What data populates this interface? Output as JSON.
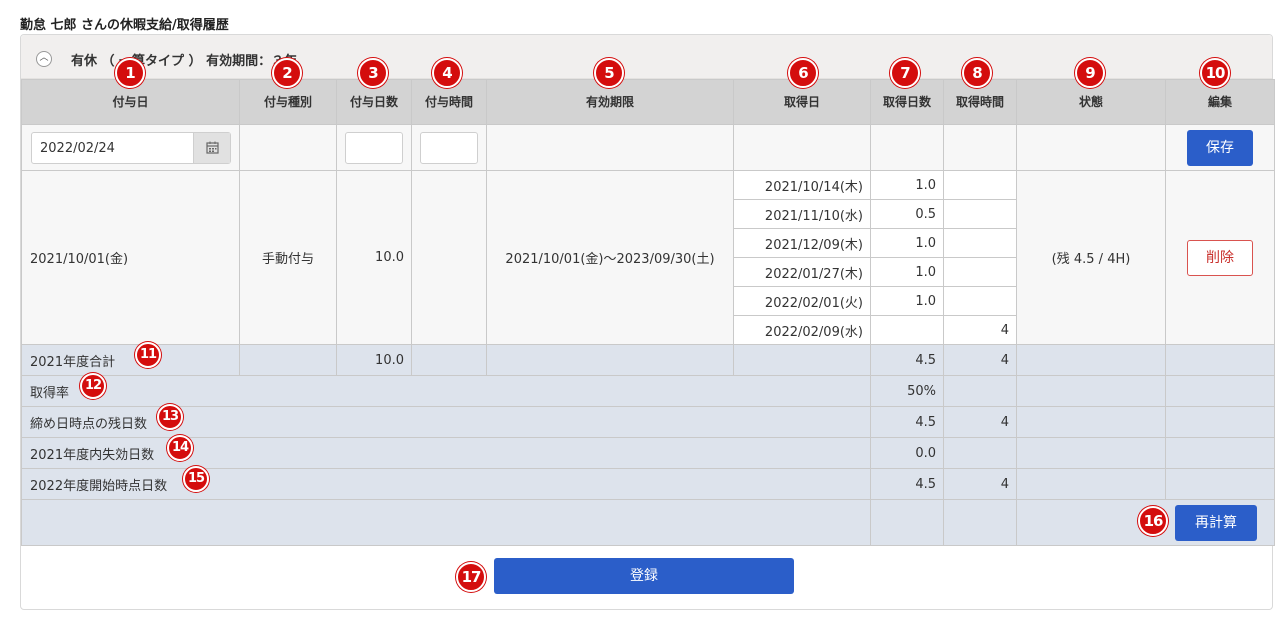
{
  "page_title": "勤怠 七郎 さんの休暇支給/取得履歴",
  "panel_header": {
    "text": "有休 （ 一算タイプ ） 有効期間：３年"
  },
  "columns": [
    "付与日",
    "付与種別",
    "付与日数",
    "付与時間",
    "有効期限",
    "取得日",
    "取得日数",
    "取得時間",
    "状態",
    "編集"
  ],
  "input_row": {
    "grant_date_value": "2022/02/24",
    "save_label": "保存"
  },
  "grant_record": {
    "grant_date": "2021/10/01(金)",
    "grant_type": "手動付与",
    "grant_days": "10.0",
    "grant_hours": "",
    "validity": "2021/10/01(金)～2023/09/30(土)",
    "status": "(残 4.5 / 4H)",
    "delete_label": "削除",
    "acquisitions": [
      {
        "date": "2021/10/14(木)",
        "days": "1.0",
        "hours": ""
      },
      {
        "date": "2021/11/10(水)",
        "days": "0.5",
        "hours": ""
      },
      {
        "date": "2021/12/09(木)",
        "days": "1.0",
        "hours": ""
      },
      {
        "date": "2022/01/27(木)",
        "days": "1.0",
        "hours": ""
      },
      {
        "date": "2022/02/01(火)",
        "days": "1.0",
        "hours": ""
      },
      {
        "date": "2022/02/09(水)",
        "days": "",
        "hours": "4"
      }
    ]
  },
  "summary": {
    "total_label": "2021年度合計",
    "total_grant_days": "10.0",
    "total_days": "4.5",
    "total_hours": "4",
    "rate_label": "取得率",
    "rate_value": "50%",
    "remaining_label": "締め日時点の残日数",
    "remaining_days": "4.5",
    "remaining_hours": "4",
    "expired_label": "2021年度内失効日数",
    "expired_days": "0.0",
    "start_label": "2022年度開始時点日数",
    "start_days": "4.5",
    "start_hours": "4",
    "recalc_label": "再計算"
  },
  "register_label": "登録",
  "callouts": [
    "1",
    "2",
    "3",
    "4",
    "5",
    "6",
    "7",
    "8",
    "9",
    "10",
    "11",
    "12",
    "13",
    "14",
    "15",
    "16",
    "17"
  ],
  "colors": {
    "primary": "#2b5ec9",
    "danger": "#d9534f",
    "callout": "#d40d0d",
    "header_bg": "#d3d3d3",
    "summary_bg": "#dde3ec"
  }
}
